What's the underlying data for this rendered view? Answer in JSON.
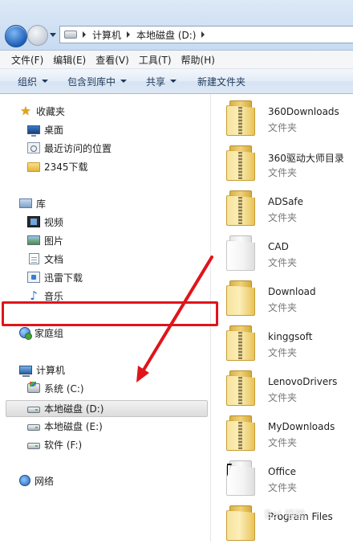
{
  "address_bar": {
    "crumbs": [
      "计算机",
      "本地磁盘 (D:)"
    ]
  },
  "menubar": {
    "items": [
      "文件(F)",
      "编辑(E)",
      "查看(V)",
      "工具(T)",
      "帮助(H)"
    ]
  },
  "toolbar": {
    "organize": "组织",
    "include_in_library": "包含到库中",
    "share": "共享",
    "new_folder": "新建文件夹"
  },
  "navpane": {
    "favorites": {
      "header": "收藏夹",
      "items": [
        "桌面",
        "最近访问的位置",
        "2345下载"
      ]
    },
    "libraries": {
      "header": "库",
      "items": [
        "视频",
        "图片",
        "文档",
        "迅雷下载",
        "音乐"
      ]
    },
    "homegroup": "家庭组",
    "computer": {
      "header": "计算机",
      "items": [
        "系统 (C:)",
        "本地磁盘 (D:)",
        "本地磁盘 (E:)",
        "软件 (F:)"
      ],
      "selected_index": 1
    },
    "network": "网络"
  },
  "files": [
    {
      "name": "360Downloads",
      "type": "文件夹"
    },
    {
      "name": "360驱动大师目录",
      "type": "文件夹"
    },
    {
      "name": "ADSafe",
      "type": "文件夹"
    },
    {
      "name": "CAD",
      "type": "文件夹"
    },
    {
      "name": "Download",
      "type": "文件夹"
    },
    {
      "name": "kinggsoft",
      "type": "文件夹"
    },
    {
      "name": "LenovoDrivers",
      "type": "文件夹"
    },
    {
      "name": "MyDownloads",
      "type": "文件夹"
    },
    {
      "name": "Office",
      "type": "文件夹"
    },
    {
      "name": "Program Files",
      "type": ""
    }
  ],
  "colors": {
    "highlight": "#e0141b",
    "folder": "#f1d27a",
    "toolbar_text": "#1e395b"
  },
  "watermark": "Bai 经验"
}
